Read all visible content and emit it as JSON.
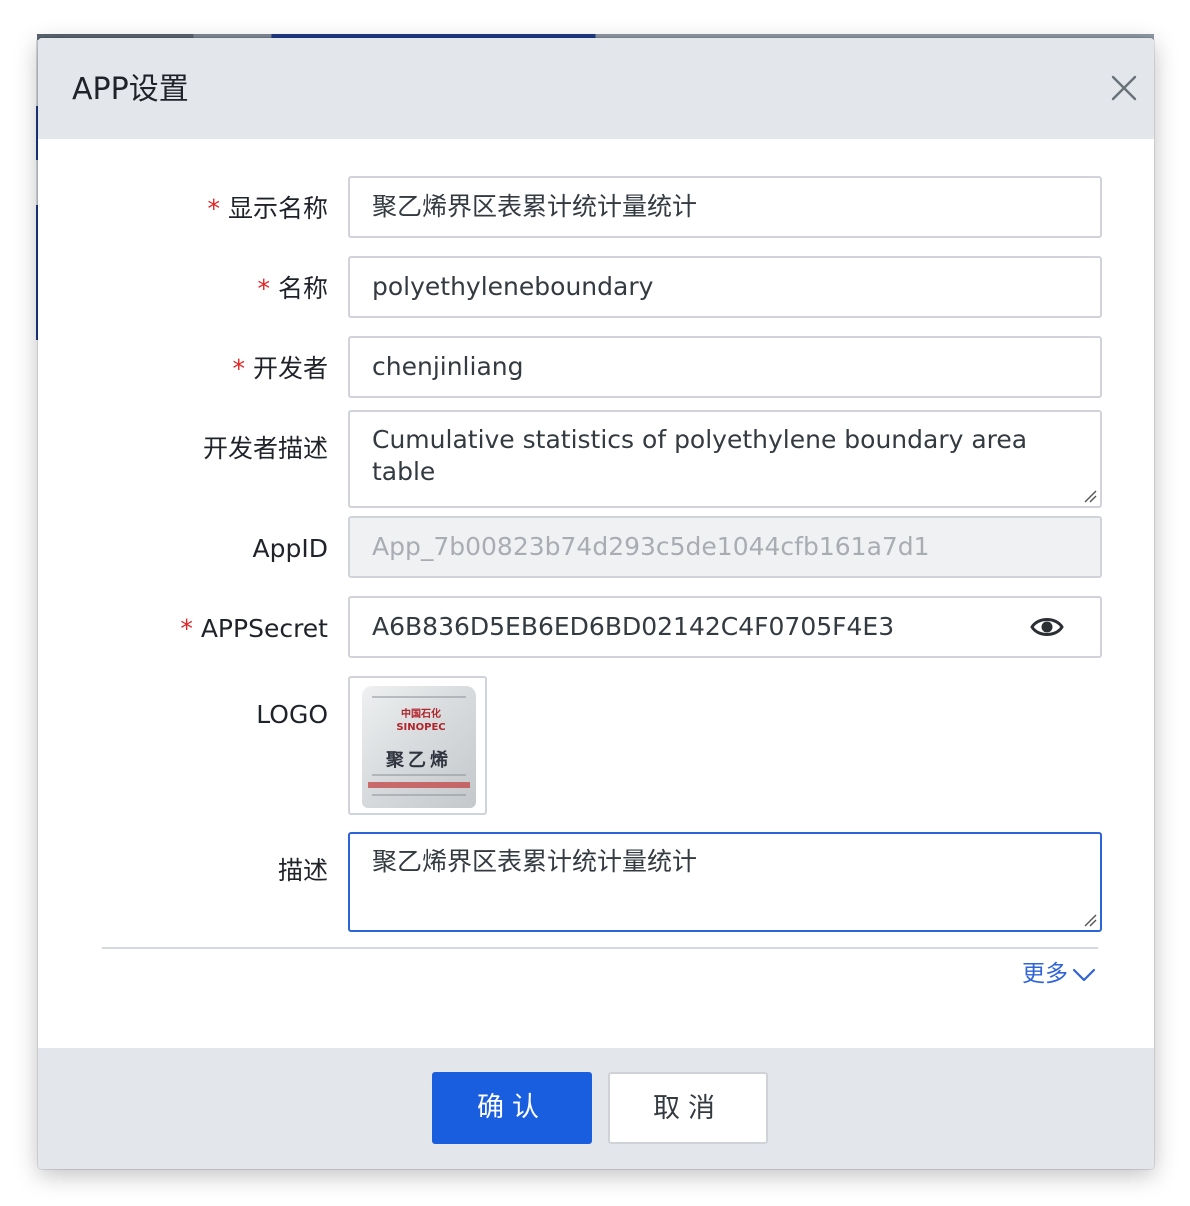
{
  "dialog": {
    "title": "APP设置"
  },
  "form": {
    "display_name": {
      "label": "显示名称",
      "required": true,
      "value": "聚乙烯界区表累计统计量统计"
    },
    "name": {
      "label": "名称",
      "required": true,
      "value": "polyethyleneboundary"
    },
    "developer": {
      "label": "开发者",
      "required": true,
      "value": "chenjinliang"
    },
    "developer_desc": {
      "label": "开发者描述",
      "required": false,
      "value": "Cumulative statistics of polyethylene boundary area table"
    },
    "app_id": {
      "label": "AppID",
      "required": false,
      "value": "App_7b00823b74d293c5de1044cfb161a7d1",
      "disabled": true
    },
    "app_secret": {
      "label": "APPSecret",
      "required": true,
      "value": "A6B836D5EB6ED6BD02142C4F0705F4E3"
    },
    "logo": {
      "label": "LOGO",
      "image_brand": "中国石化 SINOPEC",
      "image_product": "聚乙烯"
    },
    "description": {
      "label": "描述",
      "required": false,
      "value": "聚乙烯界区表累计统计量统计"
    },
    "required_mark": "*"
  },
  "more_link": "更多",
  "footer": {
    "confirm_label": "确认",
    "cancel_label": "取消"
  },
  "icons": {
    "close": "close-icon",
    "visibility": "eye-icon",
    "expand": "chevron-down-icon"
  },
  "colors": {
    "primary": "#1a5ee0",
    "required": "#e02424",
    "link": "#2f63d8",
    "header_bg": "#e3e6ea"
  }
}
